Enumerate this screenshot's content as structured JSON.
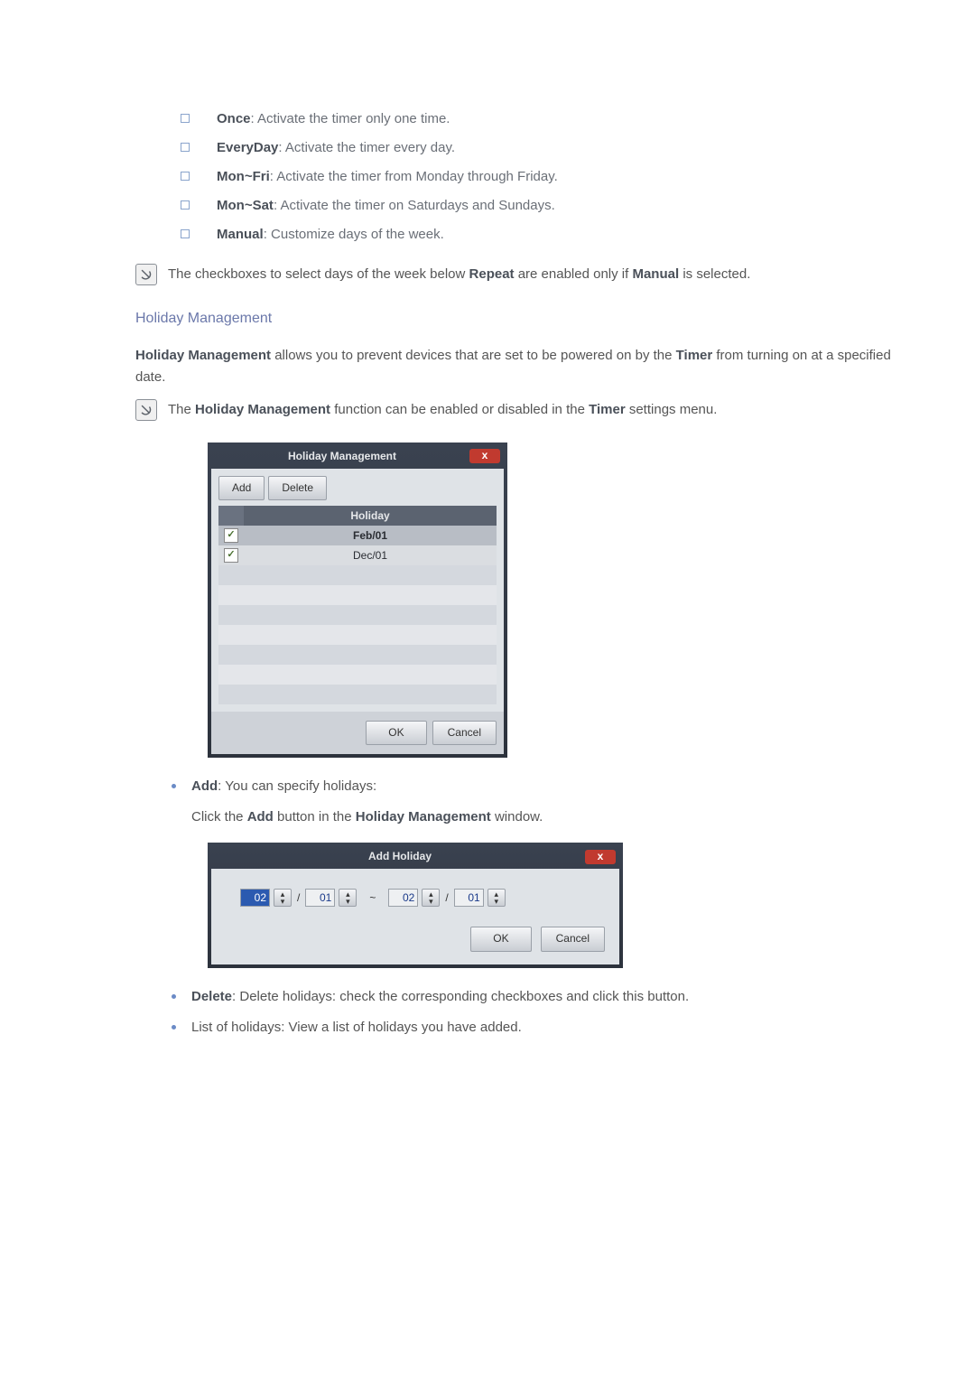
{
  "sub_items": [
    {
      "bold": "Once",
      "text": ": Activate the timer only one time."
    },
    {
      "bold": "EveryDay",
      "text": ": Activate the timer every day."
    },
    {
      "bold": "Mon~Fri",
      "text": ": Activate the timer from Monday through Friday."
    },
    {
      "bold": "Mon~Sat",
      "text": ": Activate the timer on Saturdays and Sundays."
    },
    {
      "bold": "Manual",
      "text": ": Customize days of the week."
    }
  ],
  "note1_pre": "The checkboxes to select days of the week below ",
  "note1_b1": "Repeat",
  "note1_mid": " are enabled only if ",
  "note1_b2": "Manual",
  "note1_post": " is selected.",
  "section_title": "Holiday Management",
  "section_para_pre": "",
  "section_b1": "Holiday Management",
  "section_mid1": " allows you to prevent devices that are set to be powered on by the ",
  "section_b2": "Timer",
  "section_post": " from turning on at a specified date.",
  "note2_pre": "The ",
  "note2_b1": "Holiday Management",
  "note2_mid": " function can be enabled or disabled in the ",
  "note2_b2": "Timer",
  "note2_post": " settings menu.",
  "hm_dialog": {
    "title": "Holiday Management",
    "add": "Add",
    "delete": "Delete",
    "col": "Holiday",
    "rows": [
      {
        "checked": true,
        "val": "Feb/01"
      },
      {
        "checked": true,
        "val": "Dec/01"
      }
    ],
    "ok": "OK",
    "cancel": "Cancel"
  },
  "add_item_b": "Add",
  "add_item_text": ": You can specify holidays:",
  "add_item_line2_pre": "Click the ",
  "add_item_line2_b1": "Add",
  "add_item_line2_mid": " button in the ",
  "add_item_line2_b2": "Holiday Management",
  "add_item_line2_post": " window.",
  "ah_dialog": {
    "title": "Add Holiday",
    "m1": "02",
    "d1": "01",
    "m2": "02",
    "d2": "01",
    "ok": "OK",
    "cancel": "Cancel"
  },
  "delete_b": "Delete",
  "delete_text": ": Delete holidays: check the corresponding checkboxes and click this button.",
  "list_text": "List of holidays: View a list of holidays you have added."
}
